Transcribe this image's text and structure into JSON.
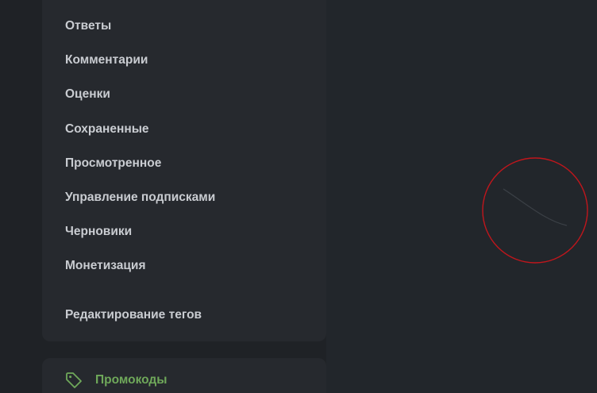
{
  "menu": {
    "items": [
      {
        "label": "Ответы"
      },
      {
        "label": "Комментарии"
      },
      {
        "label": "Оценки"
      },
      {
        "label": "Сохраненные"
      },
      {
        "label": "Просмотренное"
      },
      {
        "label": "Управление подписками"
      },
      {
        "label": "Черновики"
      },
      {
        "label": "Монетизация"
      },
      {
        "label": "Редактирование тегов"
      }
    ]
  },
  "promo": {
    "label": "Промокоды",
    "icon": "tag-icon",
    "color": "#6fa85a"
  },
  "annotation": {
    "color": "#c0161c"
  }
}
